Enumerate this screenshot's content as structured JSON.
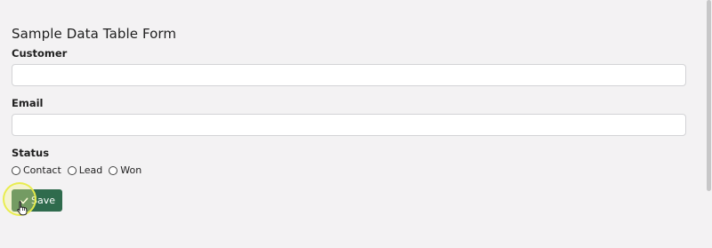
{
  "form": {
    "title": "Sample Data Table Form",
    "customer_label": "Customer",
    "customer_value": "",
    "email_label": "Email",
    "email_value": "",
    "status_label": "Status",
    "status_options": [
      "Contact",
      "Lead",
      "Won"
    ],
    "save_label": "Save"
  },
  "icons": {
    "save": "check-icon",
    "cursor": "hand-pointer-icon"
  },
  "colors": {
    "page_background": "#f3f2f3",
    "button_green": "#2f6b4d",
    "click_highlight": "#e8ec48"
  }
}
